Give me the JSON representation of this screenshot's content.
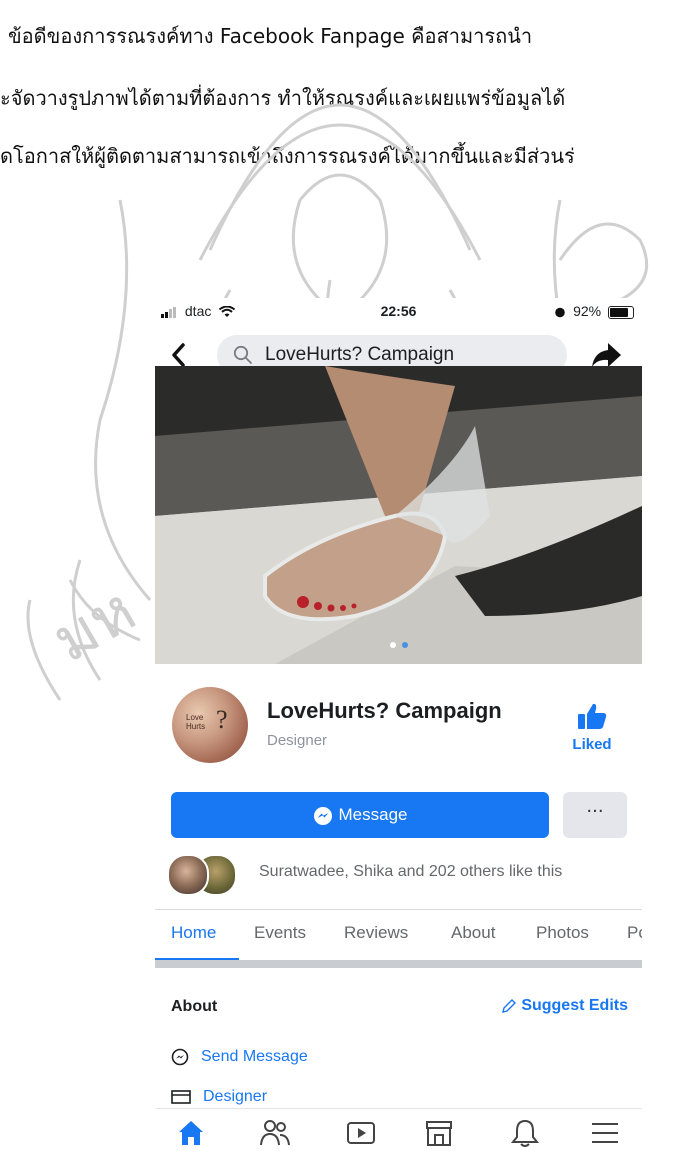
{
  "document": {
    "line1": "ข้อดีของการรณรงค์ทาง Facebook Fanpage คือสามารถนำ",
    "line2": "ะจัดวางรูปภาพได้ตามที่ต้องการ ทำให้รณรงค์และเผยแพร่ข้อมูลได้",
    "line3": "ดโอกาสให้ผู้ติดตามสามารถเข้าถึงการรณรงค์ได้มากขึ้นและมีส่วนร่"
  },
  "status_bar": {
    "carrier": "dtac",
    "time": "22:56",
    "battery": "92%",
    "battery_level": 0.92
  },
  "nav": {
    "search_value": "LoveHurts? Campaign"
  },
  "cover": {
    "slide_count": 2,
    "active_slide": 2
  },
  "profile": {
    "avatar_text_1": "Love",
    "avatar_text_2": "Hurts",
    "avatar_q": "?",
    "name": "LoveHurts? Campaign",
    "category": "Designer",
    "liked_label": "Liked"
  },
  "actions": {
    "message_label": "Message",
    "more_label": "···"
  },
  "likes": {
    "text": "Suratwadee, Shika and 202 others like this"
  },
  "tabs": [
    "Home",
    "Events",
    "Reviews",
    "About",
    "Photos",
    "Po"
  ],
  "about": {
    "heading": "About",
    "suggest_label": "Suggest Edits",
    "rows": [
      "Send Message",
      "Designer"
    ]
  },
  "colors": {
    "accent": "#1877f2",
    "muted": "#65676b"
  }
}
